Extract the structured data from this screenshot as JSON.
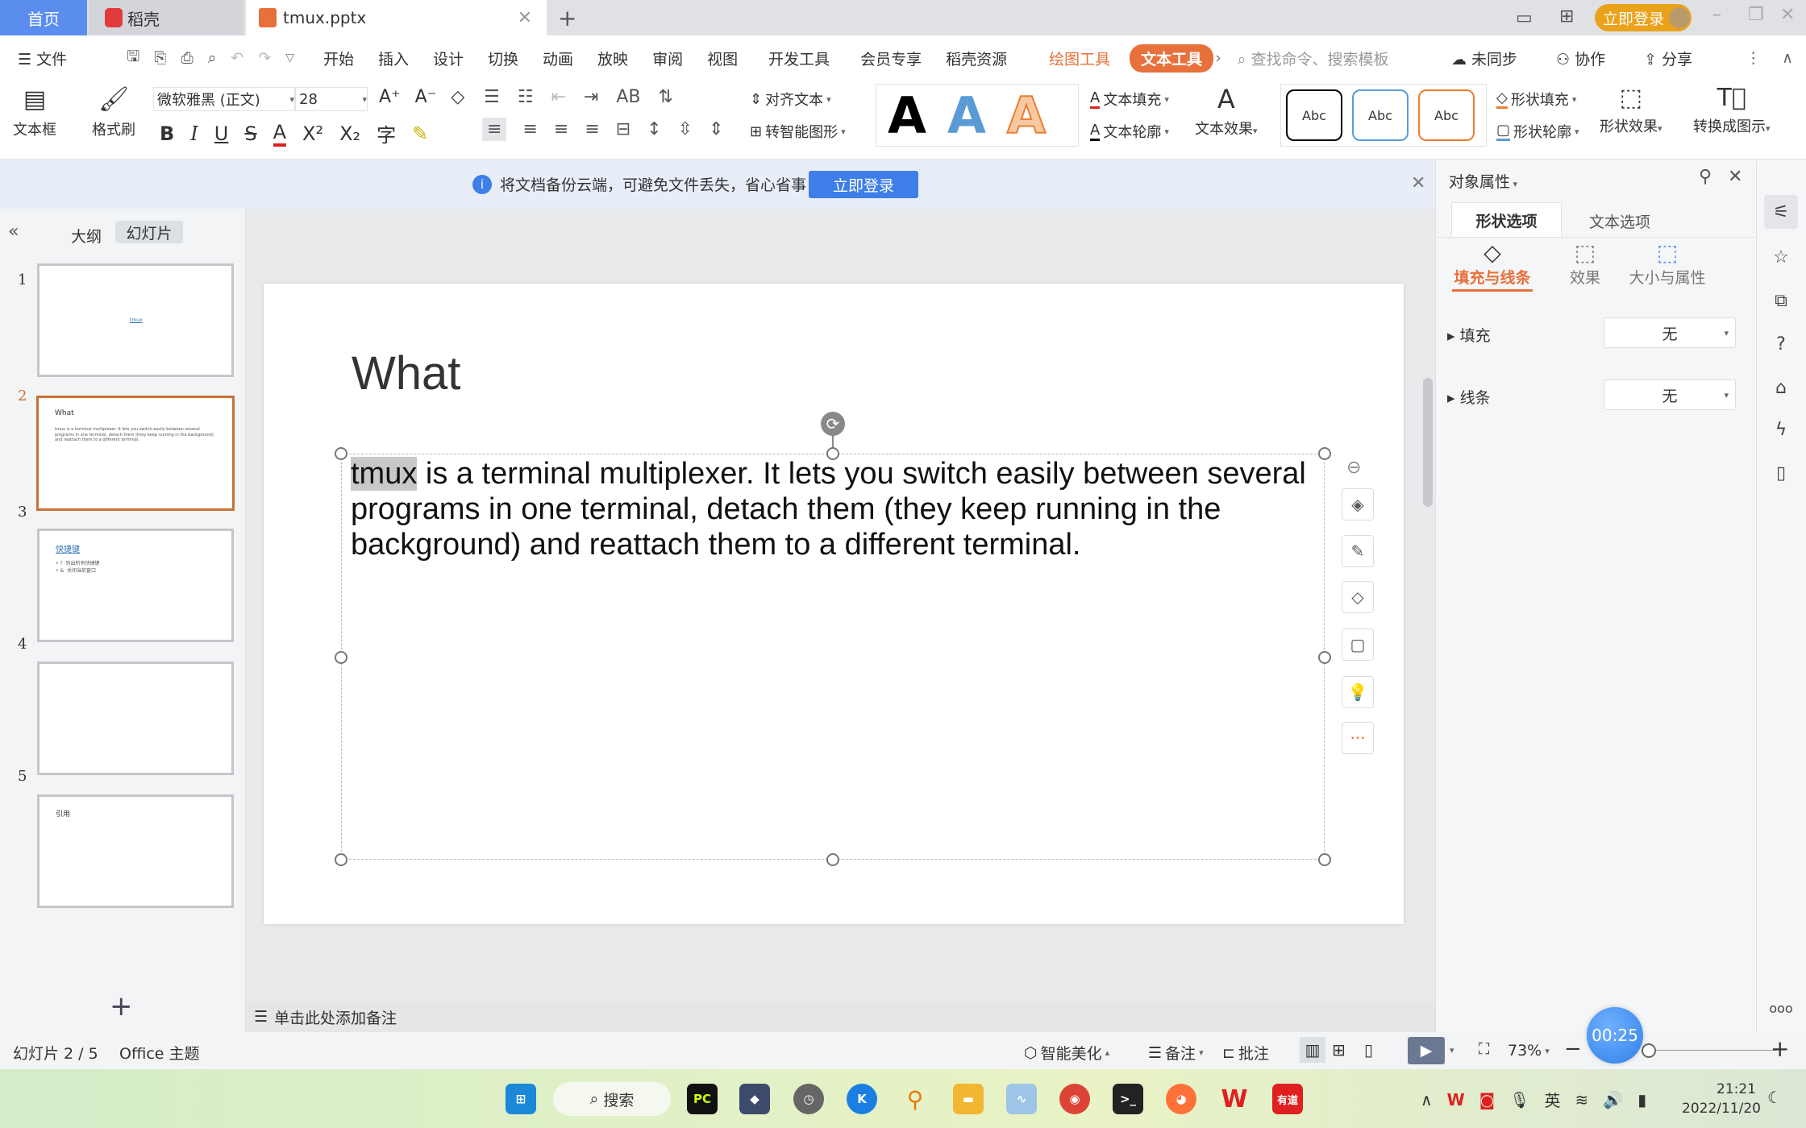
{
  "tabs": {
    "home": "首页",
    "daoke": "稻壳",
    "doc": "tmux.pptx",
    "new_tab": "+",
    "login": "立即登录"
  },
  "menu": {
    "file": "文件",
    "items": [
      "开始",
      "插入",
      "设计",
      "切换",
      "动画",
      "放映",
      "审阅",
      "视图",
      "开发工具",
      "会员专享",
      "稻壳资源"
    ],
    "drawing_tools": "绘图工具",
    "text_tools": "文本工具",
    "search_placeholder": "查找命令、搜索模板",
    "sync": "未同步",
    "collab": "协作",
    "share": "分享"
  },
  "ribbon": {
    "textbox": "文本框",
    "format_painter": "格式刷",
    "font": "微软雅黑 (正文)",
    "size": "28",
    "align_text": "对齐文本",
    "smart_shape": "转智能图形",
    "text_fill": "文本填充",
    "text_outline": "文本轮廓",
    "text_effect": "文本效果",
    "shape_styles": [
      "Abc",
      "Abc",
      "Abc"
    ],
    "shape_fill": "形状填充",
    "shape_outline": "形状轮廓",
    "shape_effect": "形状效果",
    "convert": "转换成图示",
    "wordart": [
      "A",
      "A",
      "A"
    ],
    "bold": "B",
    "italic": "I",
    "underline": "U",
    "strike": "S",
    "fontcolor": "A"
  },
  "notice": {
    "text": "将文档备份云端，可避免文件丢失，省心省事",
    "button": "立即登录"
  },
  "leftpanel": {
    "outline": "大纲",
    "slides": "幻灯片",
    "add": "+",
    "thumbs": [
      {
        "num": "1",
        "title": "tmux",
        "body": ""
      },
      {
        "num": "2",
        "title": "What",
        "body": "tmux is a terminal multiplexer. It lets you switch easily between several programs in one terminal, detach them (they keep running in the background) and reattach them to a different terminal."
      },
      {
        "num": "3",
        "title": "快捷键",
        "body": "• ?  列出所有快捷键\n• &  关闭当前窗口"
      },
      {
        "num": "4",
        "title": "",
        "body": ""
      },
      {
        "num": "5",
        "title": "引用",
        "body": ""
      }
    ]
  },
  "slide": {
    "title": "What",
    "highlight": "tmux",
    "body": " is a terminal multiplexer. It lets you switch easily between several programs in one terminal, detach them (they keep running in the background) and reattach them to a different terminal."
  },
  "rpanel": {
    "title": "对象属性",
    "tab_shape": "形状选项",
    "tab_text": "文本选项",
    "sub": [
      "填充与线条",
      "效果",
      "大小与属性"
    ],
    "fill_label": "填充",
    "fill_value": "无",
    "line_label": "线条",
    "line_value": "无"
  },
  "notes": {
    "placeholder": "单击此处添加备注"
  },
  "status": {
    "slide": "幻灯片 2 / 5",
    "theme": "Office 主题",
    "beautify": "智能美化",
    "notes": "备注",
    "comment": "批注",
    "zoom": "73%",
    "timer": "00:25"
  },
  "taskbar": {
    "search": "搜索",
    "time": "21:21",
    "date": "2022/11/20",
    "ime": "英",
    "youdao": "有道"
  },
  "colors": {
    "accent": "#e8703a",
    "home_tab": "#5b8def",
    "primary": "#3e7ee8",
    "login": "#eba21b"
  }
}
